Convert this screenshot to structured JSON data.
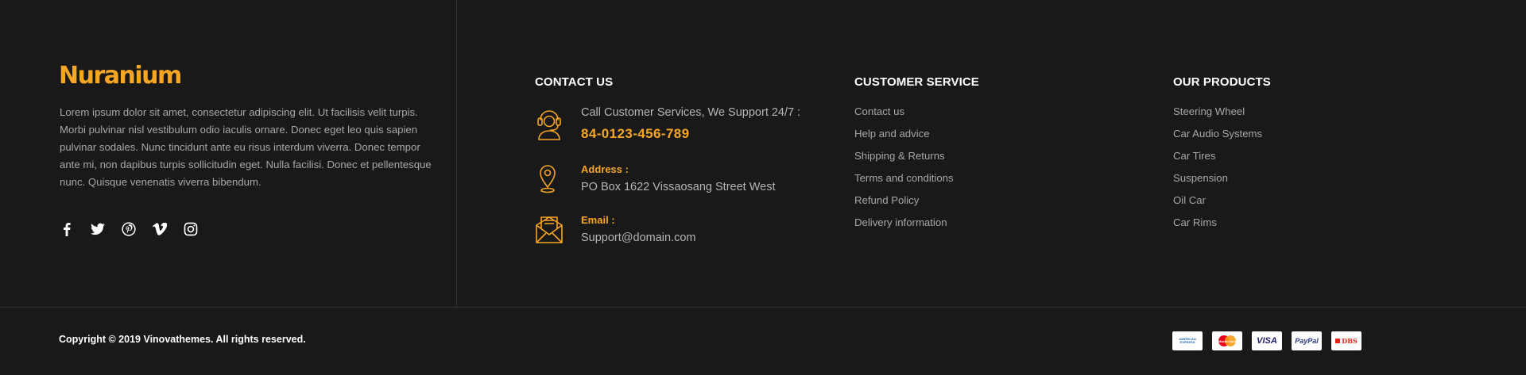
{
  "brand": {
    "logo": "Nuranium",
    "accent_color": "#f5a623",
    "background": "#191919"
  },
  "about": {
    "text": "Lorem ipsum dolor sit amet, consectetur adipiscing elit. Ut facilisis velit turpis. Morbi pulvinar nisl vestibulum odio iaculis ornare. Donec eget leo quis sapien pulvinar sodales. Nunc tincidunt ante eu risus interdum viverra. Donec tempor ante mi, non dapibus turpis sollicitudin eget. Nulla facilisi. Donec et pellentesque nunc. Quisque venenatis viverra bibendum."
  },
  "social": [
    "facebook-icon",
    "twitter-icon",
    "pinterest-icon",
    "vimeo-icon",
    "instagram-icon"
  ],
  "contact": {
    "title": "CONTACT US",
    "support_text": "Call Customer Services, We Support 24/7 :",
    "phone": "84-0123-456-789",
    "address_label": "Address :",
    "address": "PO Box 1622 Vissaosang Street West",
    "email_label": "Email :",
    "email": "Support@domain.com"
  },
  "customer_service": {
    "title": "CUSTOMER SERVICE",
    "links": [
      "Contact us",
      "Help and advice",
      "Shipping & Returns",
      "Terms and conditions",
      "Refund Policy",
      "Delivery information"
    ]
  },
  "products": {
    "title": "OUR PRODUCTS",
    "links": [
      "Steering Wheel",
      "Car Audio Systems",
      "Car Tires",
      "Suspension",
      "Oil Car",
      "Car Rims"
    ]
  },
  "footer": {
    "copyright": "Copyright © 2019 Vinovathemes. All rights reserved.",
    "payments": {
      "amex": "AMERICAN EXPRESS",
      "mastercard": "MasterCard",
      "visa": "VISA",
      "paypal": "PayPal",
      "dbs": "DBS"
    }
  }
}
